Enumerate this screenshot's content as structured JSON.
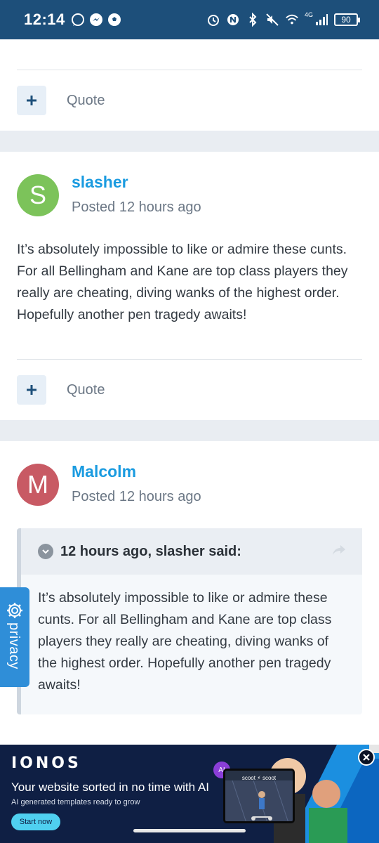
{
  "status_bar": {
    "time": "12:14",
    "battery": "90",
    "network": "4G"
  },
  "post_prev": {
    "quote_label": "Quote"
  },
  "post_slasher": {
    "avatar_letter": "S",
    "avatar_color": "#7cc35a",
    "author": "slasher",
    "posted": "Posted 12 hours ago",
    "body": "It’s absolutely impossible to like or admire these cunts. For all  Bellingham and Kane are top class players they really are cheating, diving wanks of the highest order. Hopefully another pen tragedy awaits!",
    "quote_label": "Quote"
  },
  "post_malcolm": {
    "avatar_letter": "M",
    "avatar_color": "#c85a64",
    "author": "Malcolm",
    "posted": "Posted 12 hours ago",
    "quote": {
      "citation": "12 hours ago, slasher said:",
      "body": "It’s absolutely impossible to like or admire these cunts. For all  Bellingham and Kane are top class players they really are cheating, diving wanks of the highest order. Hopefully another pen tragedy awaits!"
    }
  },
  "privacy_tab": {
    "label": "privacy"
  },
  "ad": {
    "brand": "IONOS",
    "headline": "Your website sorted in no time with AI",
    "subline": "AI generated templates ready to grow",
    "cta": "Start now",
    "ai_badge": "AI",
    "screen_text": "scoot ⚡ scoot"
  }
}
